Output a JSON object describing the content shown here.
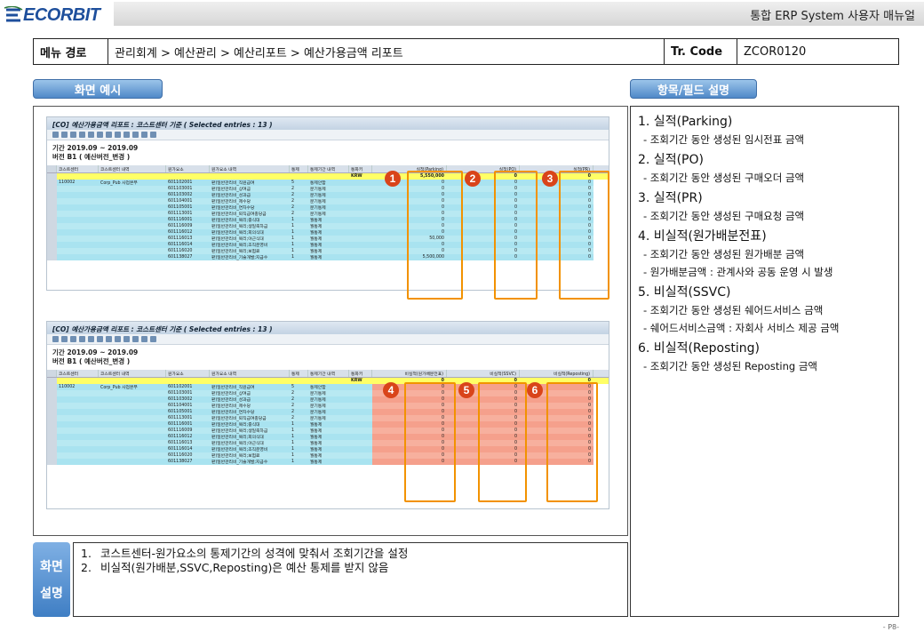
{
  "header": {
    "logo": "ECORBIT",
    "title": "통합 ERP System 사용자 매뉴얼"
  },
  "menu": {
    "path_label": "메뉴 경로",
    "path": "관리회계 > 예산관리 > 예산리포트 > 예산가용금액 리포트",
    "tcode_label": "Tr. Code",
    "tcode": "ZCOR0120"
  },
  "tabs": {
    "example": "화면 예시",
    "fields": "항목/필드 설명"
  },
  "sap": {
    "title": "[CO] 예산가용금액 리포트 : 코스트센터 기준 ( Selected entries : 13 )",
    "period_label": "기간",
    "period": "2019.09 ~ 2019.09",
    "version_label": "버전",
    "version": "B1 ( 예산버전_변경 )",
    "headers": [
      "코스트센터",
      "코스트센터 내역",
      "원가요소",
      "원가요소 내역",
      "통제",
      "통제기간 내역",
      "통화키"
    ],
    "col_titles_1": [
      "실적(Parking)",
      "실적(PO)",
      "실적(PR)"
    ],
    "col_titles_2": [
      "비실적(원가배분전표)",
      "비실적(SSVC)",
      "비실적(Reposting)"
    ],
    "currency": "KRW",
    "total_1": [
      "5,550,000",
      "0",
      "0"
    ],
    "cost_center": "110002",
    "cost_center_name": "Corp_Pub 사업본부",
    "rows": [
      {
        "ce": "601102001",
        "cen": "판)일반관리비_직원급여",
        "cs": "5",
        "per": "통제안함"
      },
      {
        "ce": "601103001",
        "cen": "판)일반관리비_상여금",
        "cs": "2",
        "per": "분기통제"
      },
      {
        "ce": "601103002",
        "cen": "판)일반관리비_성과급",
        "cs": "2",
        "per": "분기통제"
      },
      {
        "ce": "601104001",
        "cen": "판)일반관리비_제수당",
        "cs": "2",
        "per": "분기통제"
      },
      {
        "ce": "601105001",
        "cen": "판)일반관리비_연차수당",
        "cs": "2",
        "per": "분기통제"
      },
      {
        "ce": "601113001",
        "cen": "판)일반관리비_퇴직급여충당금",
        "cs": "2",
        "per": "분기통제"
      },
      {
        "ce": "601116001",
        "cen": "판)일반관리비_복리;중식대",
        "cs": "1",
        "per": "월통제"
      },
      {
        "ce": "601116009",
        "cen": "판)일반관리비_복리;생일축하금",
        "cs": "1",
        "per": "월통제"
      },
      {
        "ce": "601116012",
        "cen": "판)일반관리비_복리;회의식대",
        "cs": "1",
        "per": "월통제"
      },
      {
        "ce": "601116013",
        "cen": "판)일반관리비_복리;야근식대",
        "cs": "1",
        "per": "월통제"
      },
      {
        "ce": "601116014",
        "cen": "판)일반관리비_복리;조직운영비",
        "cs": "1",
        "per": "월통제"
      },
      {
        "ce": "601116020",
        "cen": "판)일반관리비_복리;보험료",
        "cs": "1",
        "per": "월통제"
      },
      {
        "ce": "601138027",
        "cen": "판)일반관리비_기술개발;지급수",
        "cs": "1",
        "per": "월통제"
      }
    ],
    "values_parking": [
      "0",
      "0",
      "0",
      "0",
      "0",
      "0",
      "0",
      "0",
      "0",
      "50,000",
      "0",
      "0",
      "5,500,000"
    ],
    "values_zero": "0"
  },
  "badges": [
    "1",
    "2",
    "3",
    "4",
    "5",
    "6"
  ],
  "description": {
    "label_1": "화면",
    "label_2": "설명",
    "items": [
      {
        "num": "1.",
        "text": "코스트센터-원가요소의 통제기간의 성격에 맞춰서 조회기간을 설정"
      },
      {
        "num": "2.",
        "text": "비실적(원가배분,SSVC,Reposting)은 예산 통제를 받지 않음"
      }
    ]
  },
  "fields": [
    {
      "title": "1. 실적(Parking)",
      "desc": [
        "- 조회기간 동안 생성된 임시전표 금액"
      ]
    },
    {
      "title": "2. 실적(PO)",
      "desc": [
        "- 조회기간 동안 생성된 구매오더 금액"
      ]
    },
    {
      "title": "3. 실적(PR)",
      "desc": [
        "- 조회기간 동안 생성된 구매요청 금액"
      ]
    },
    {
      "title": "4. 비실적(원가배분전표)",
      "desc": [
        "- 조회기간 동안 생성된 원가배분 금액",
        "- 원가배분금액 : 관계사와 공동 운영 시 발생"
      ]
    },
    {
      "title": "5. 비실적(SSVC)",
      "desc": [
        "- 조회기간 동안 생성된 쉐어드서비스 금액",
        "- 쉐어드서비스금액 : 자회사 서비스 제공 금액"
      ]
    },
    {
      "title": "6. 비실적(Reposting)",
      "desc": [
        "- 조회기간 동안 생성된 Reposting 금액"
      ]
    }
  ],
  "page_number": "- P8-",
  "colors": {
    "accent_blue": "#4f88c8",
    "highlight_orange": "#f29200",
    "badge_red": "#d9441a",
    "row_cyan": "#a9e3f0",
    "row_red": "#f5a08c"
  }
}
